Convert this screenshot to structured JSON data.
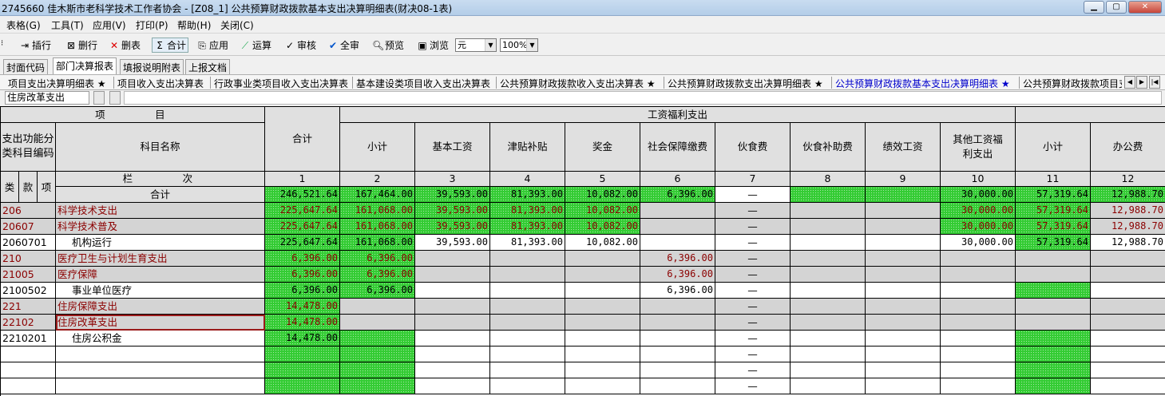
{
  "window": {
    "title": "2745660  佳木斯市老科学技术工作者协会 - [Z08_1] 公共预算财政拨款基本支出决算明细表(财决08-1表)"
  },
  "menu": [
    "表格(G)",
    "工具(T)",
    "应用(V)",
    "打印(P)",
    "帮助(H)",
    "关闭(C)"
  ],
  "toolbar": {
    "buttons": [
      {
        "label": "插行",
        "icon": "insert-row-icon"
      },
      {
        "label": "删行",
        "icon": "delete-row-icon"
      },
      {
        "label": "删表",
        "icon": "delete-table-icon"
      },
      {
        "label": "合计",
        "icon": "sum-icon"
      },
      {
        "label": "应用",
        "icon": "apply-icon"
      },
      {
        "label": "运算",
        "icon": "calculate-icon"
      },
      {
        "label": "审核",
        "icon": "check-icon"
      },
      {
        "label": "全审",
        "icon": "check-all-icon"
      },
      {
        "label": "预览",
        "icon": "preview-icon"
      },
      {
        "label": "浏览",
        "icon": "browse-icon"
      }
    ],
    "unit": "元",
    "zoom": "100%"
  },
  "tabs_top": [
    "封面代码",
    "部门决算报表",
    "填报说明附表",
    "上报文档"
  ],
  "tabs_top_active": 1,
  "tabs_sub": [
    "项目支出决算明细表 ★",
    "项目收入支出决算表",
    "行政事业类项目收入支出决算表",
    "基本建设类项目收入支出决算表",
    "公共预算财政拨款收入支出决算表 ★",
    "公共预算财政拨款支出决算明细表 ★",
    "公共预算财政拨款基本支出决算明细表 ★",
    "公共预算财政拨款项目支出"
  ],
  "tabs_sub_active": 6,
  "namebox": "住房改革支出",
  "sheet": {
    "h_project": "项　　　目",
    "h_code": "支出功能分类科目编码",
    "h_name": "科目名称",
    "h_total": "合计",
    "h_welfare": "工资福利支出",
    "h_cols": [
      "小计",
      "基本工资",
      "津贴补贴",
      "奖金",
      "社会保障缴费",
      "伙食费",
      "伙食补助费",
      "绩效工资",
      "其他工资福利支出",
      "小计",
      "办公费"
    ],
    "h_lanci": "栏　　　次",
    "h_lei": "类",
    "h_kuan": "款",
    "h_xiang": "项",
    "col_nums": [
      "1",
      "2",
      "3",
      "4",
      "5",
      "6",
      "7",
      "8",
      "9",
      "10",
      "11",
      "12"
    ],
    "rows": [
      {
        "code": "",
        "name": "合计",
        "vals": [
          "246,521.64",
          "167,464.00",
          "39,593.00",
          "81,393.00",
          "10,082.00",
          "6,396.00",
          "—",
          "",
          "",
          "30,000.00",
          "57,319.64",
          "12,988.70"
        ]
      },
      {
        "code": "206",
        "name": "科学技术支出",
        "vals": [
          "225,647.64",
          "161,068.00",
          "39,593.00",
          "81,393.00",
          "10,082.00",
          "",
          "—",
          "",
          "",
          "30,000.00",
          "57,319.64",
          "12,988.70"
        ]
      },
      {
        "code": "20607",
        "name": "科学技术普及",
        "vals": [
          "225,647.64",
          "161,068.00",
          "39,593.00",
          "81,393.00",
          "10,082.00",
          "",
          "—",
          "",
          "",
          "30,000.00",
          "57,319.64",
          "12,988.70"
        ]
      },
      {
        "code": "2060701",
        "name": "机构运行",
        "vals": [
          "225,647.64",
          "161,068.00",
          "39,593.00",
          "81,393.00",
          "10,082.00",
          "",
          "—",
          "",
          "",
          "30,000.00",
          "57,319.64",
          "12,988.70"
        ]
      },
      {
        "code": "210",
        "name": "医疗卫生与计划生育支出",
        "vals": [
          "6,396.00",
          "6,396.00",
          "",
          "",
          "",
          "6,396.00",
          "—",
          "",
          "",
          "",
          "",
          ""
        ]
      },
      {
        "code": "21005",
        "name": "医疗保障",
        "vals": [
          "6,396.00",
          "6,396.00",
          "",
          "",
          "",
          "6,396.00",
          "—",
          "",
          "",
          "",
          "",
          ""
        ]
      },
      {
        "code": "2100502",
        "name": "事业单位医疗",
        "vals": [
          "6,396.00",
          "6,396.00",
          "",
          "",
          "",
          "6,396.00",
          "—",
          "",
          "",
          "",
          "",
          ""
        ]
      },
      {
        "code": "221",
        "name": "住房保障支出",
        "vals": [
          "14,478.00",
          "",
          "",
          "",
          "",
          "",
          "—",
          "",
          "",
          "",
          "",
          ""
        ]
      },
      {
        "code": "22102",
        "name": "住房改革支出",
        "vals": [
          "14,478.00",
          "",
          "",
          "",
          "",
          "",
          "—",
          "",
          "",
          "",
          "",
          ""
        ]
      },
      {
        "code": "2210201",
        "name": "住房公积金",
        "vals": [
          "14,478.00",
          "",
          "",
          "",
          "",
          "",
          "—",
          "",
          "",
          "",
          "",
          ""
        ]
      },
      {
        "code": "",
        "name": "",
        "vals": [
          "",
          "",
          "",
          "",
          "",
          "",
          "—",
          "",
          "",
          "",
          "",
          ""
        ]
      },
      {
        "code": "",
        "name": "",
        "vals": [
          "",
          "",
          "",
          "",
          "",
          "",
          "—",
          "",
          "",
          "",
          "",
          ""
        ]
      },
      {
        "code": "",
        "name": "",
        "vals": [
          "",
          "",
          "",
          "",
          "",
          "",
          "—",
          "",
          "",
          "",
          "",
          ""
        ]
      }
    ]
  }
}
